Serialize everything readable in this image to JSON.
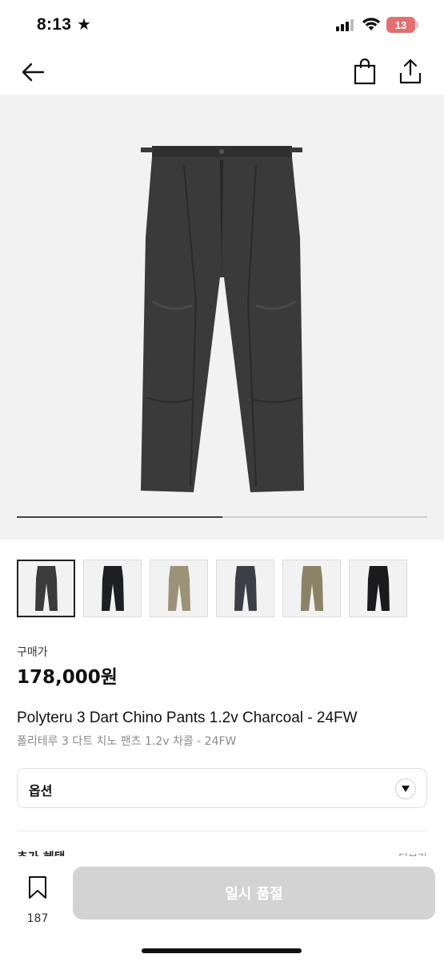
{
  "status_bar": {
    "time": "8:13",
    "star_icon": "star-icon",
    "battery_level": "13",
    "icons": [
      "signal-icon",
      "wifi-icon",
      "battery-icon"
    ]
  },
  "nav": {
    "back_icon": "arrow-left-icon",
    "bag_icon": "shopping-bag-icon",
    "share_icon": "share-icon"
  },
  "gallery": {
    "progress_fraction": 0.5,
    "thumbnails": [
      {
        "color": "#3b3b3b",
        "selected": true
      },
      {
        "color": "#1e1f22",
        "selected": false
      },
      {
        "color": "#9b9278",
        "selected": false
      },
      {
        "color": "#3d3f47",
        "selected": false
      },
      {
        "color": "#8b8268",
        "selected": false
      },
      {
        "color": "#1b1b1d",
        "selected": false
      }
    ]
  },
  "product": {
    "price_label": "구매가",
    "price": "178,000원",
    "title_en": "Polyteru 3 Dart Chino Pants 1.2v Charcoal - 24FW",
    "title_ko": "폴리테루 3 다트 치노 팬츠 1.2v 차콜 - 24FW"
  },
  "option": {
    "label": "옵션",
    "chevron_icon": "chevron-down-icon"
  },
  "extra": {
    "label": "추가 혜택",
    "more": "더보기"
  },
  "bottom_bar": {
    "wish_icon": "bookmark-icon",
    "wish_count": "187",
    "action_label": "일시 품절"
  },
  "colors": {
    "product_charcoal": "#3a3a3a",
    "soldout_button": "#d3d3d3",
    "battery": "#e36f6f"
  }
}
